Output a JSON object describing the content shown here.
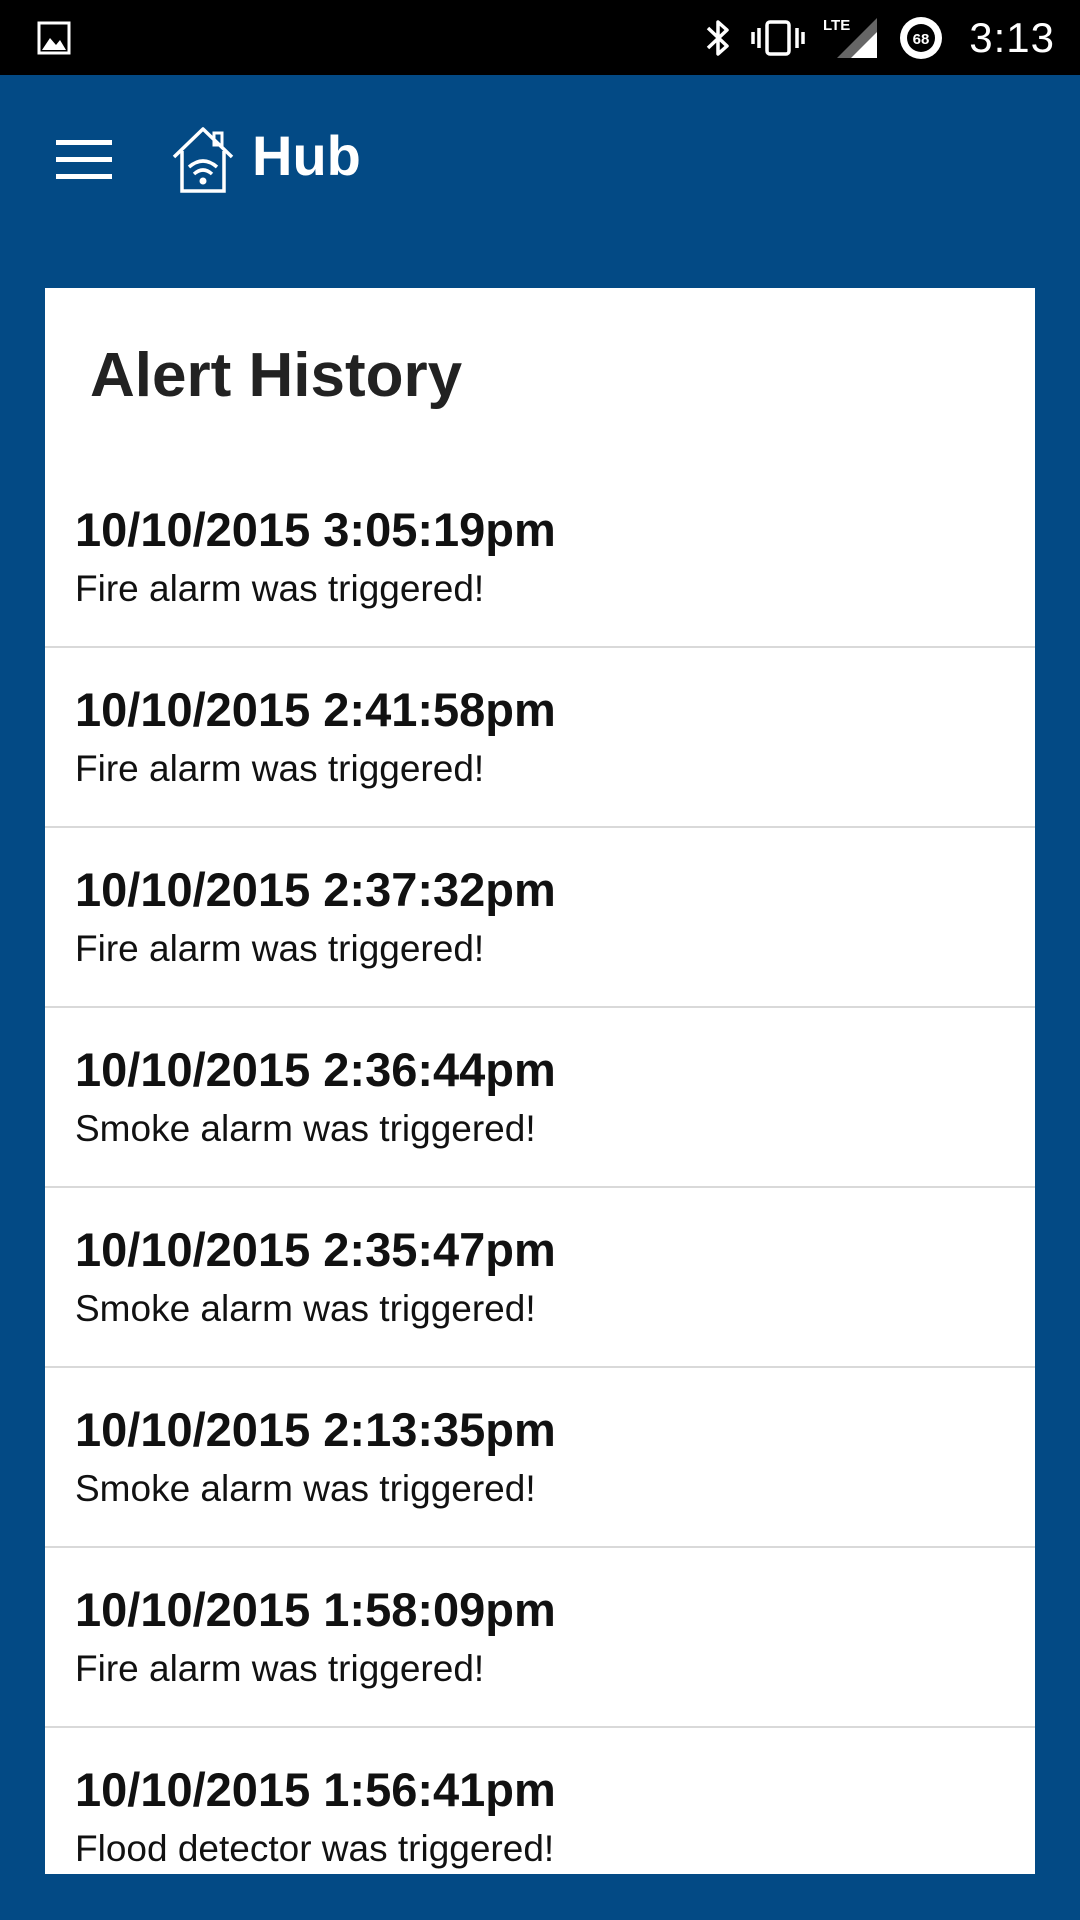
{
  "status_bar": {
    "time": "3:13",
    "battery_level": "68",
    "network_label": "LTE",
    "icons": [
      "image-icon",
      "bluetooth-icon",
      "vibrate-icon",
      "lte-signal-icon",
      "battery-icon"
    ]
  },
  "app_bar": {
    "title": "Hub",
    "menu_icon": "hamburger-menu-icon",
    "logo_icon": "home-wifi-icon"
  },
  "colors": {
    "app_background": "#034a85",
    "status_bar": "#000000",
    "card_background": "#ffffff",
    "divider": "#d9d9d9"
  },
  "card": {
    "title": "Alert History",
    "alerts": [
      {
        "time": "10/10/2015 3:05:19pm",
        "message": "Fire alarm was triggered!"
      },
      {
        "time": "10/10/2015 2:41:58pm",
        "message": "Fire alarm was triggered!"
      },
      {
        "time": "10/10/2015 2:37:32pm",
        "message": "Fire alarm was triggered!"
      },
      {
        "time": "10/10/2015 2:36:44pm",
        "message": "Smoke alarm was triggered!"
      },
      {
        "time": "10/10/2015 2:35:47pm",
        "message": "Smoke alarm was triggered!"
      },
      {
        "time": "10/10/2015 2:13:35pm",
        "message": "Smoke alarm was triggered!"
      },
      {
        "time": "10/10/2015 1:58:09pm",
        "message": "Fire alarm was triggered!"
      },
      {
        "time": "10/10/2015 1:56:41pm",
        "message": "Flood detector was triggered!"
      }
    ]
  }
}
